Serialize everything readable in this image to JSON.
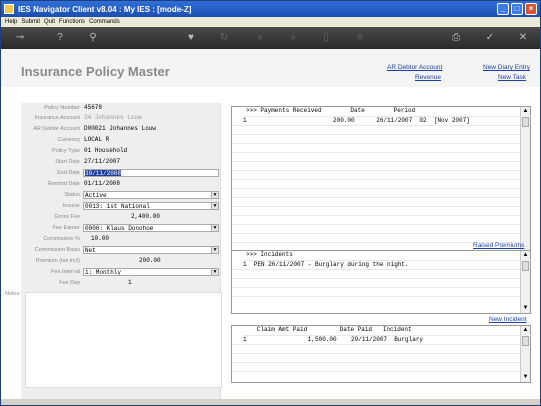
{
  "window": {
    "title": "IES Navigator Client v8.04 : My IES :      [mode-Z]"
  },
  "menu": [
    "Help",
    "Submit",
    "Quit",
    "Functions",
    "Commands"
  ],
  "page": {
    "title": "Insurance Policy Master"
  },
  "links": {
    "ar_debtor_account": "AR Debtor Account",
    "revenue": "Revenue",
    "new_diary_entry": "New Diary Entry",
    "new_task": "New Task",
    "raised_premiums": "Raised Premiums",
    "new_incident": "New Incident"
  },
  "form": {
    "policy_number": {
      "label": "Policy Number",
      "value": "45678"
    },
    "insurance_account": {
      "label": "Insurance Account",
      "value": "34 Johannes Louw"
    },
    "ar_debtor_account": {
      "label": "AR Debtor Account",
      "value": "D00021 Johannes Louw"
    },
    "currency": {
      "label": "Currency",
      "value": "LOCAL R"
    },
    "policy_type": {
      "label": "Policy Type",
      "value": "01 Household"
    },
    "start_date": {
      "label": "Start Date",
      "value": "27/11/2007"
    },
    "end_date": {
      "label": "End Date",
      "value": "30/11/2008"
    },
    "remind_date": {
      "label": "Remind Date",
      "value": "01/11/2008"
    },
    "status": {
      "label": "Status",
      "value": "Active"
    },
    "insurer": {
      "label": "Insurer",
      "value": "0013: 1st National"
    },
    "gross_fee": {
      "label": "Gross Fee",
      "value": "2,400.00"
    },
    "fee_earner": {
      "label": "Fee Earner",
      "value": "0006: Klaus Donohoe"
    },
    "commission_pct": {
      "label": "Commission %",
      "value": "10.00"
    },
    "commission_basis": {
      "label": "Commission Basis",
      "value": "Net"
    },
    "premium": {
      "label": "Premium (tax incl)",
      "value": "200.00"
    },
    "fee_interval": {
      "label": "Fee Interval",
      "value": "1: Monthly"
    },
    "fee_day": {
      "label": "Fee Day",
      "value": "1"
    },
    "notes": {
      "label": "Notes"
    }
  },
  "payments": {
    "header": ">>> Payments Received        Date        Period",
    "rows": [
      "1                        200.00      26/11/2007  02  [Nov 2007]"
    ]
  },
  "incidents": {
    "header": ">>> Incidents",
    "rows": [
      "1  PEN 26/11/2007 - Burglary during the night."
    ]
  },
  "claims": {
    "header": "   Claim Amt Paid         Date Paid   Incident",
    "rows": [
      "1                 1,500.00    29/11/2007  Burglary"
    ]
  }
}
